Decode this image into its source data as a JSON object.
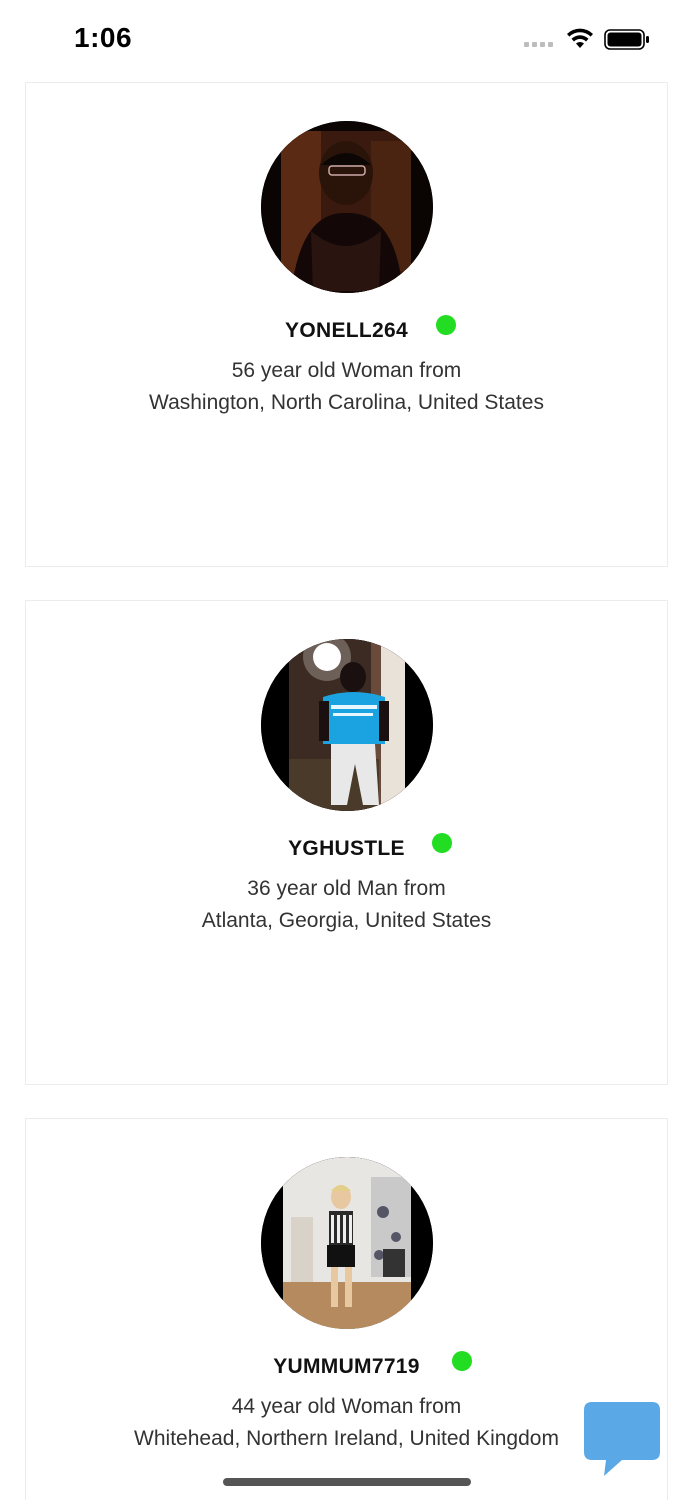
{
  "status_bar": {
    "time": "1:06",
    "signal_icon": "cellular-signal-icon",
    "wifi_icon": "wifi-icon",
    "battery_icon": "battery-icon"
  },
  "profiles": [
    {
      "username": "YONELL264",
      "online": true,
      "description_line1": "56 year old Woman from",
      "description_line2": "Washington, North Carolina, United States"
    },
    {
      "username": "YGHUSTLE",
      "online": true,
      "description_line1": "36 year old Man from",
      "description_line2": "Atlanta, Georgia, United States"
    },
    {
      "username": "YUMMUM7719",
      "online": true,
      "description_line1": "44 year old Woman from",
      "description_line2": "Whitehead, Northern Ireland, United Kingdom"
    }
  ],
  "chat_button": {
    "icon": "chat-bubble-icon",
    "color": "#5aa9e6"
  },
  "colors": {
    "online": "#22dd22",
    "card_border": "#ececec"
  }
}
